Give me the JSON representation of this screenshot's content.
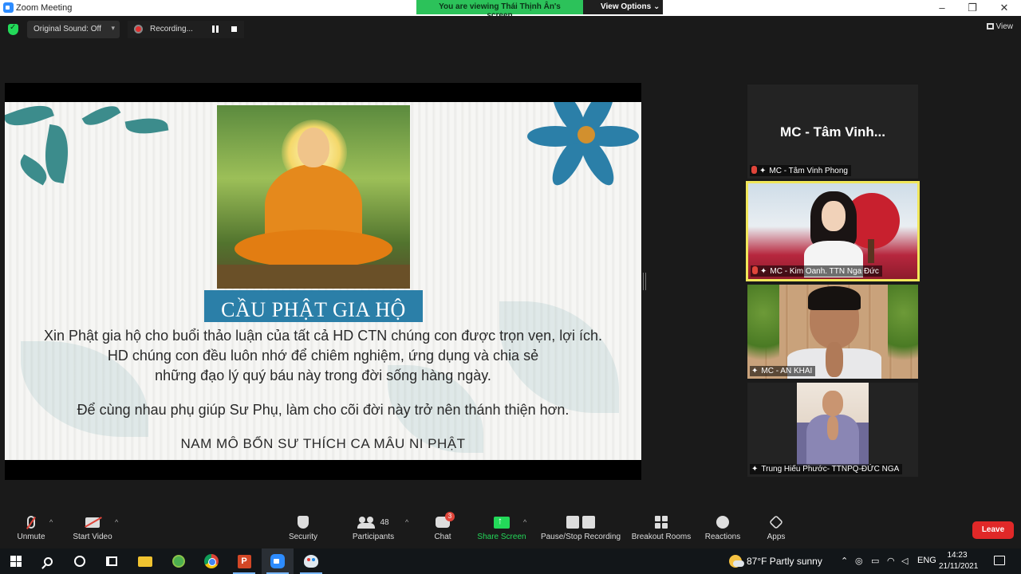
{
  "window": {
    "title": "Zoom Meeting",
    "minimize": "–",
    "maximize": "❐",
    "close": "✕"
  },
  "banner": {
    "viewing": "You are viewing Thái Thịnh Ân's screen",
    "view_options": "View Options ⌄"
  },
  "topbar": {
    "original_sound": "Original Sound: Off",
    "recording": "Recording...",
    "view": "View"
  },
  "slide": {
    "title": "CẦU PHẬT GIA HỘ",
    "lines": [
      "Xin Phật gia hộ cho buổi thảo luận của tất cả HD CTN chúng con được trọn vẹn, lợi ích.",
      "HD chúng con đều luôn nhớ để chiêm nghiệm, ứng dụng và chia sẻ",
      "những đạo lý quý báu này trong đời sống hàng  ngày.",
      "Để cùng nhau phụ giúp Sư Phụ, làm cho cõi đời này trở nên thánh thiện hơn.",
      "NAM MÔ BỔN SƯ THÍCH CA MÂU NI PHẬT"
    ]
  },
  "participants": [
    {
      "display_name": "MC - Tâm Vinh...",
      "label": "MC - Tâm Vinh Phong",
      "muted": true
    },
    {
      "label": "MC - Kim Oanh. TTN Nga Đức",
      "muted": true,
      "active_speaker": true
    },
    {
      "label": "MC - AN KHAI",
      "muted": false
    },
    {
      "label": "Trung Hiếu Phước- TTNPQ-ĐỨC NGA",
      "muted": false
    }
  ],
  "toolbar": {
    "unmute": "Unmute",
    "start_video": "Start Video",
    "security": "Security",
    "participants": "Participants",
    "participants_count": "48",
    "chat": "Chat",
    "chat_badge": "3",
    "share_screen": "Share Screen",
    "pause_stop_recording": "Pause/Stop Recording",
    "breakout_rooms": "Breakout Rooms",
    "reactions": "Reactions",
    "apps": "Apps",
    "leave": "Leave",
    "caret": "^"
  },
  "taskbar": {
    "ppt_letter": "P",
    "weather": "87°F  Partly sunny",
    "language": "ENG",
    "time": "14:23",
    "date": "21/11/2021"
  },
  "colors": {
    "share_green": "#23d959",
    "leave_red": "#e02828",
    "active_border": "#f1e75a",
    "slide_title_band": "#2b7fa8"
  }
}
